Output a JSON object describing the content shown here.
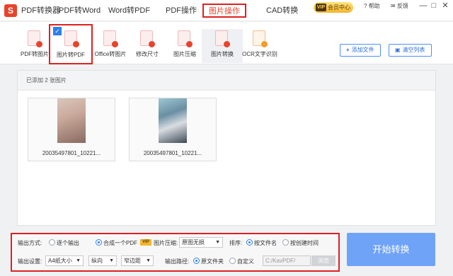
{
  "app": {
    "logo_letter": "S",
    "vip_label": "会员中心",
    "vip_mark": "VIP",
    "help_label": "帮助",
    "feedback_label": "反馈",
    "minimize": "—",
    "maximize": "□",
    "close": "✕"
  },
  "nav": {
    "tabs": [
      {
        "label": "PDF转换器"
      },
      {
        "label": "PDF转Word"
      },
      {
        "label": "Word转PDF"
      },
      {
        "label": "PDF操作"
      },
      {
        "label": "图片操作"
      },
      {
        "label": "CAD转换"
      }
    ],
    "active": "图片操作"
  },
  "toolbar": {
    "tools": [
      {
        "label": "PDF转图片",
        "icon": "pdf-to-image-icon"
      },
      {
        "label": "图片转PDF",
        "icon": "image-to-pdf-icon"
      },
      {
        "label": "Office转图片",
        "icon": "office-to-image-icon"
      },
      {
        "label": "修改尺寸",
        "icon": "resize-icon"
      },
      {
        "label": "图片压缩",
        "icon": "compress-icon"
      },
      {
        "label": "图片转换",
        "icon": "image-convert-icon"
      },
      {
        "label": "OCR文字识别",
        "icon": "ocr-icon"
      }
    ],
    "selected": "图片转PDF",
    "add_file_label": "添加文件",
    "clear_list_label": "清空列表"
  },
  "file_list": {
    "count_text": "已添加 2 张图片",
    "files": [
      {
        "name": "20035497801_10221..."
      },
      {
        "name": "20035497801_10221..."
      }
    ]
  },
  "settings": {
    "output_mode_label": "输出方式:",
    "output_each": "逐个输出",
    "output_merge": "合成一个PDF",
    "vip_tag": "VIP",
    "compress_label": "图片压缩:",
    "compress_value": "原图无损",
    "sort_label": "排序:",
    "sort_by_name": "按文件名",
    "sort_by_time": "按创建时间",
    "output_settings_label": "输出设置:",
    "page_size": "A4纸大小",
    "orientation": "纵向",
    "margin": "窄边距",
    "output_path_label": "输出路径:",
    "path_source": "原文件夹",
    "path_custom": "自定义",
    "path_value": "C:/KavPDF/",
    "browse_label": "浏览"
  },
  "start_button": "开始转换",
  "colors": {
    "accent": "#2a7ef0",
    "brand": "#e8432b",
    "start_button": "#6fa3f7",
    "highlight_border": "#e02020"
  }
}
